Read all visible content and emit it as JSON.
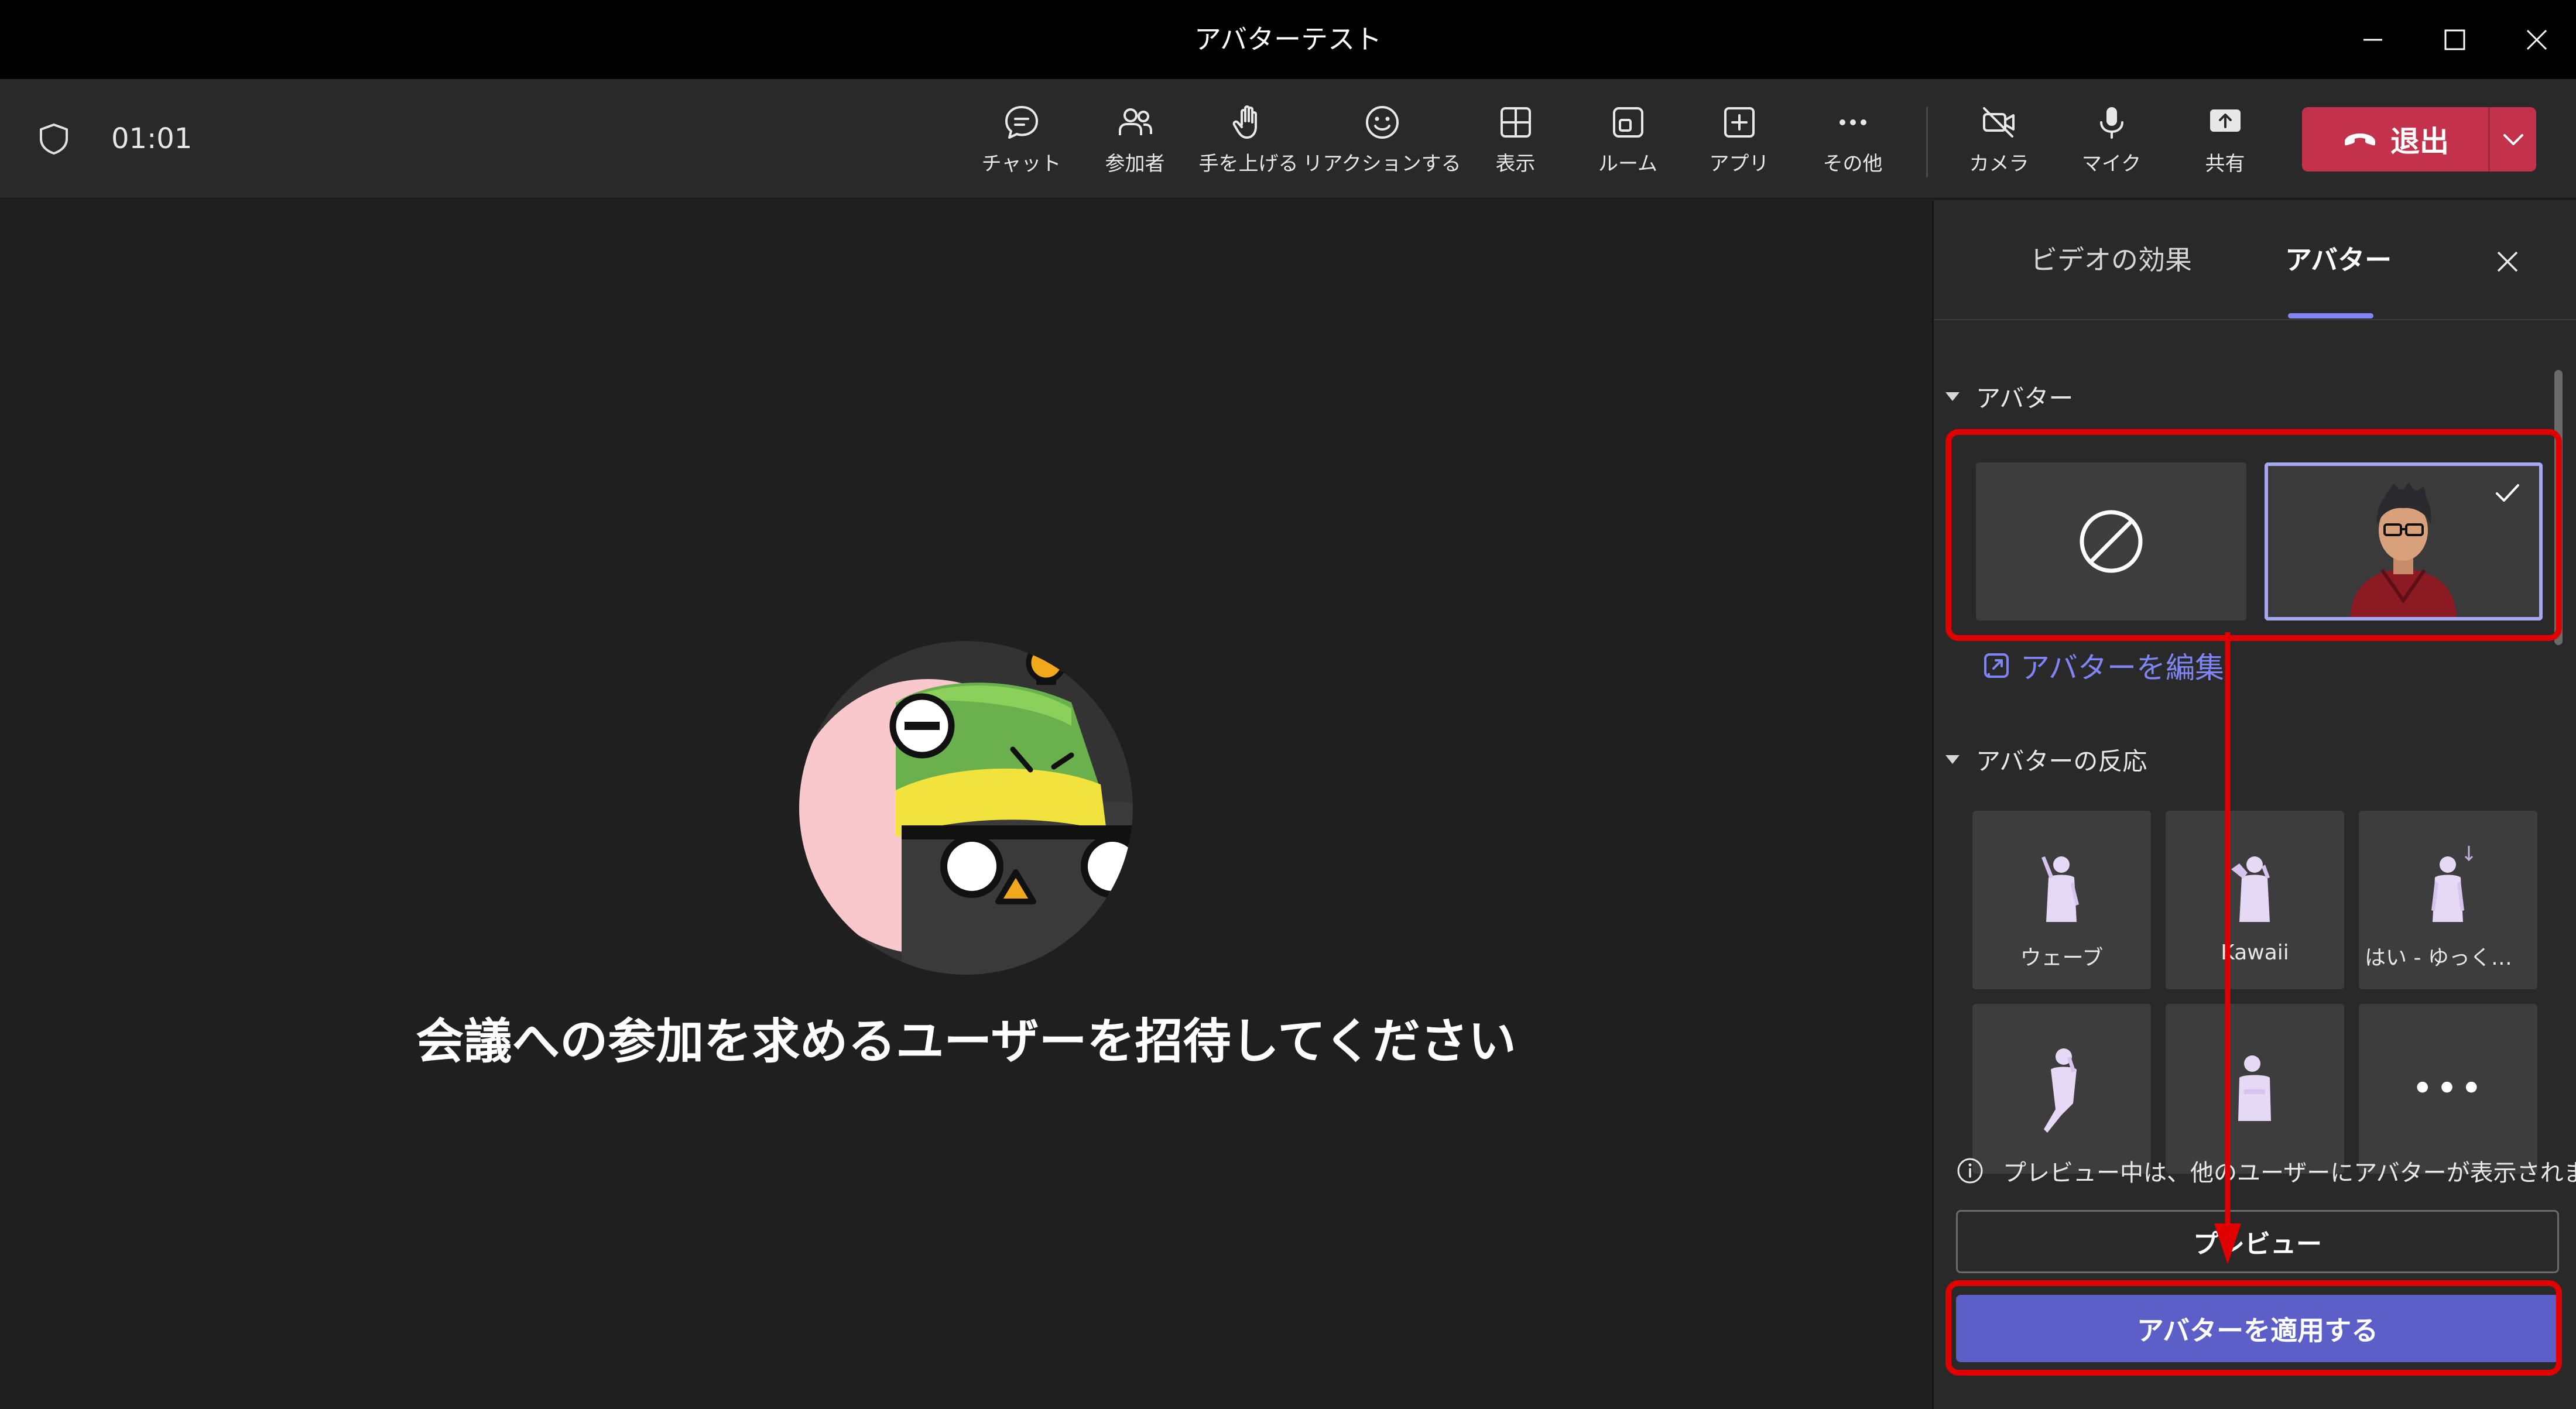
{
  "window": {
    "title": "アバターテスト"
  },
  "toolbar": {
    "timer": "01:01",
    "buttons": {
      "chat": "チャット",
      "participants": "参加者",
      "raise_hand": "手を上げる",
      "reactions": "リアクションする",
      "view": "表示",
      "rooms": "ルーム",
      "apps": "アプリ",
      "more": "その他",
      "camera": "カメラ",
      "mic": "マイク",
      "share": "共有"
    },
    "leave_label": "退出"
  },
  "stage": {
    "invite_text": "会議への参加を求めるユーザーを招待してください"
  },
  "panel": {
    "tabs": {
      "video_effects": "ビデオの効果",
      "avatar": "アバター"
    },
    "avatar_section_title": "アバター",
    "edit_avatar_link": "アバターを編集",
    "reactions_section_title": "アバターの反応",
    "reactions": [
      "ウェーブ",
      "Kawaii",
      "はい - ゆっくり..."
    ],
    "more_glyph": "•••",
    "notice": "プレビュー中は、他のユーザーにアバターが表示されません。",
    "preview_button": "プレビュー",
    "apply_button": "アバターを適用する"
  },
  "colors": {
    "background": "#1f1f1f",
    "toolbar": "#292929",
    "leave_red": "#c4314b",
    "accent": "#7f85f5",
    "apply_purple": "#5b5fc7",
    "highlight_red": "#e00000"
  }
}
